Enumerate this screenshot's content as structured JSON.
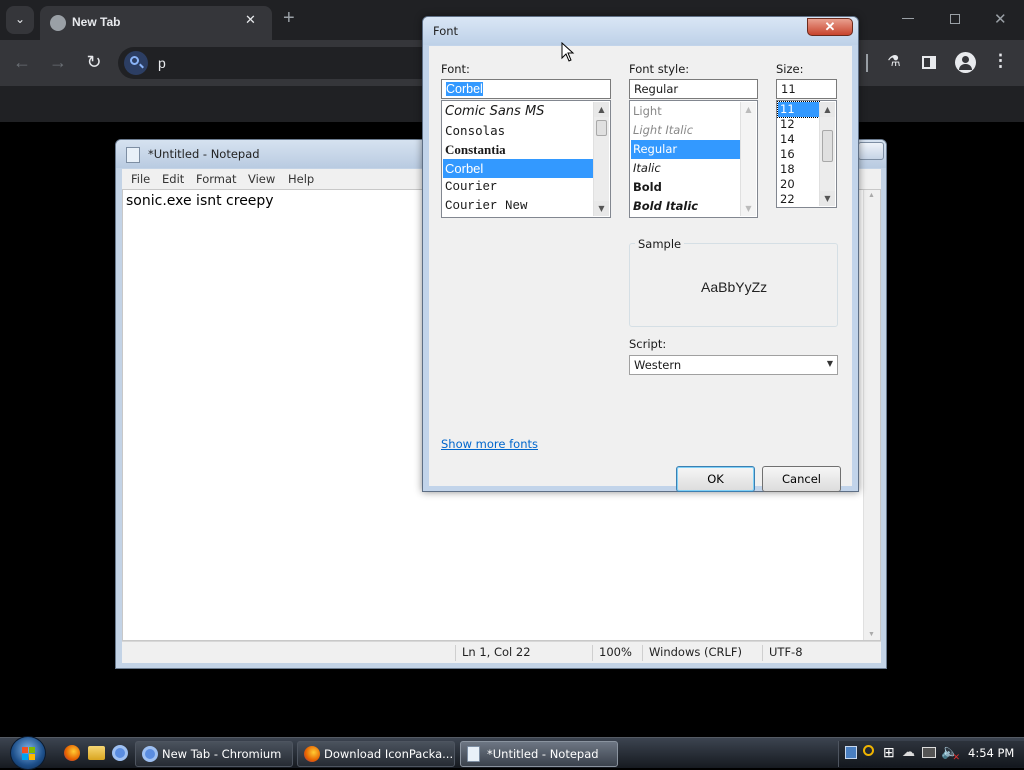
{
  "browser": {
    "tab_title": "New Tab",
    "omnibox_text": "p",
    "colors": {
      "frame": "#202124",
      "toolbar": "#35363a",
      "text": "#e8eaed"
    }
  },
  "notepad": {
    "title": "*Untitled - Notepad",
    "menu": [
      "File",
      "Edit",
      "Format",
      "View",
      "Help"
    ],
    "content": "sonic.exe isnt creepy",
    "status": {
      "position": "Ln 1, Col 22",
      "zoom": "100%",
      "line_endings": "Windows (CRLF)",
      "encoding": "UTF-8"
    }
  },
  "font_dialog": {
    "title": "Font",
    "close_glyph": "✕",
    "font_label": "Font:",
    "font_value": "Corbel",
    "font_list": [
      "Comic Sans MS",
      "Consolas",
      "Constantia",
      "Corbel",
      "Courier",
      "Courier New"
    ],
    "font_selected": "Corbel",
    "style_label": "Font style:",
    "style_value": "Regular",
    "style_list": [
      "Light",
      "Light Italic",
      "Regular",
      "Italic",
      "Bold",
      "Bold Italic"
    ],
    "style_selected": "Regular",
    "size_label": "Size:",
    "size_value": "11",
    "size_list": [
      "11",
      "12",
      "14",
      "16",
      "18",
      "20",
      "22"
    ],
    "size_selected": "11",
    "sample_label": "Sample",
    "sample_text": "AaBbYyZz",
    "script_label": "Script:",
    "script_value": "Western",
    "show_more_link": "Show more fonts",
    "ok_label": "OK",
    "cancel_label": "Cancel",
    "colors": {
      "selection": "#3399ff",
      "link": "#0066cc"
    }
  },
  "taskbar": {
    "items": [
      {
        "label": "New Tab - Chromium",
        "icon": "chromium-icon"
      },
      {
        "label": "Download IconPacka...",
        "icon": "firefox-icon"
      },
      {
        "label": "*Untitled - Notepad",
        "icon": "notepad-icon"
      }
    ],
    "clock": "4:54 PM"
  }
}
